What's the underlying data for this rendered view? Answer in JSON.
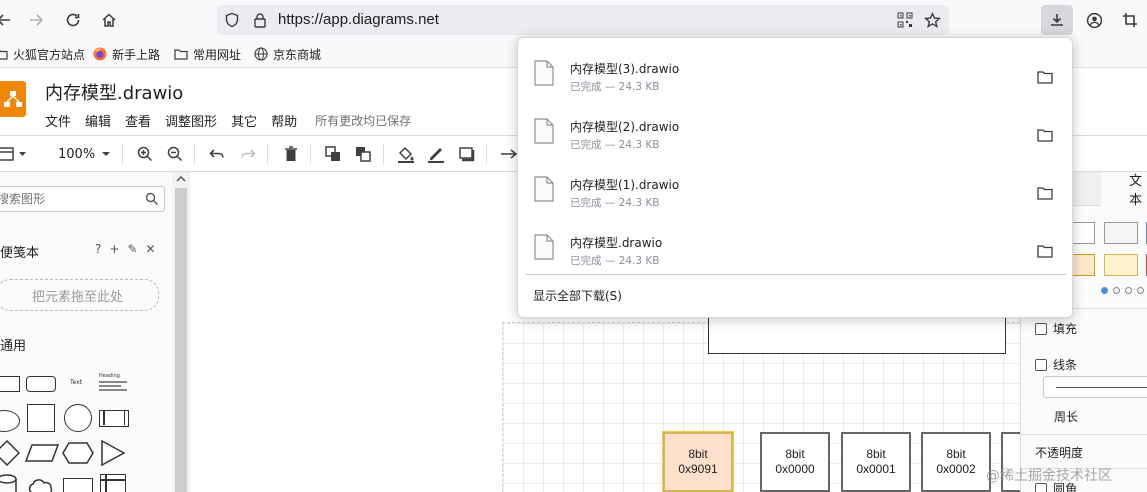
{
  "browser": {
    "url": "https://app.diagrams.net",
    "bookmarks": [
      {
        "label": "火狐官方站点",
        "icon": "folder-icon"
      },
      {
        "label": "新手上路",
        "icon": "firefox-icon"
      },
      {
        "label": "常用网址",
        "icon": "folder-icon"
      },
      {
        "label": "京东商城",
        "icon": "globe-icon"
      }
    ]
  },
  "app": {
    "title": "内存模型.drawio",
    "menu": [
      "文件",
      "编辑",
      "查看",
      "调整图形",
      "其它",
      "帮助"
    ],
    "save_status": "所有更改均已保存",
    "zoom": "100%"
  },
  "sidebar": {
    "search_placeholder": "搜索图形",
    "scratchpad_title": "便笺本",
    "scratchpad_tools": [
      "?",
      "+",
      "✎",
      "✕"
    ],
    "drop_hint": "把元素拖至此处",
    "general_title": "通用",
    "text_shape_label": "Text",
    "heading_shape_label": "Heading"
  },
  "canvas": {
    "cells": [
      {
        "bits": "8bit",
        "addr": "0x9091",
        "highlight": true
      },
      {
        "bits": "8bit",
        "addr": "0x0000",
        "highlight": false
      },
      {
        "bits": "8bit",
        "addr": "0x0001",
        "highlight": false
      },
      {
        "bits": "8bit",
        "addr": "0x0002",
        "highlight": false
      }
    ]
  },
  "format_panel": {
    "text_tab": "文本",
    "fill_label": "填充",
    "line_label": "线条",
    "perimeter_label": "周长",
    "opacity_label": "不透明度",
    "rounded_label": "圆角"
  },
  "downloads": {
    "items": [
      {
        "name": "内存模型(3).drawio",
        "status": "已完成 — 24.3 KB"
      },
      {
        "name": "内存模型(2).drawio",
        "status": "已完成 — 24.3 KB"
      },
      {
        "name": "内存模型(1).drawio",
        "status": "已完成 — 24.3 KB"
      },
      {
        "name": "内存模型.drawio",
        "status": "已完成 — 24.3 KB"
      }
    ],
    "show_all": "显示全部下载(S)"
  },
  "watermark": "@稀土掘金技术社区"
}
